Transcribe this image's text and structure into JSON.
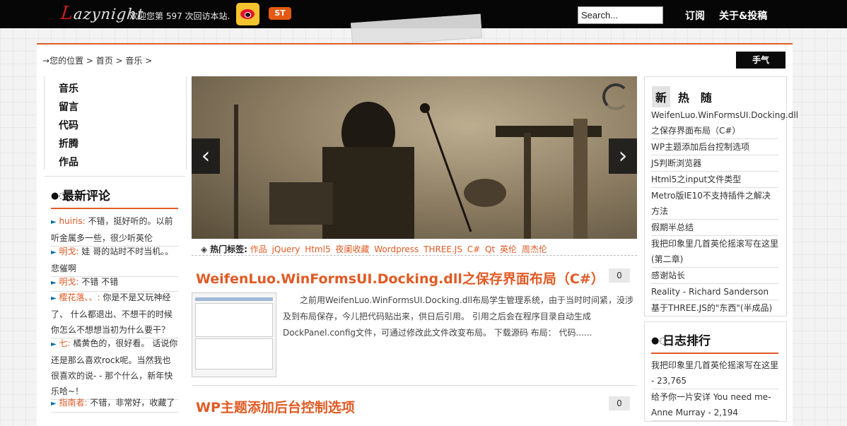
{
  "header": {
    "logo_text": "Lazynight",
    "logo_first": "L",
    "logo_rest": "azynight",
    "welcome": "欢迎您第 597 次回访本站.",
    "st_badge": "ST",
    "search_placeholder": "Search...",
    "nav": [
      "订阅",
      "关于&投稿"
    ]
  },
  "breadcrumb": {
    "arrow": "→",
    "text": "您的位置 > 首页 > 音乐 >"
  },
  "weather_button": "手气",
  "left_nav": [
    "音乐",
    "留言",
    "代码",
    "折腾",
    "作品"
  ],
  "recent_comments": {
    "title": "最新评论",
    "items": [
      {
        "name": "huiris:",
        "text": " 不错，挺好听的。以前听金属多一些，很少听英伦"
      },
      {
        "name": "明戈:",
        "text": " 娃 哥的站时不时当机。。悲催啊"
      },
      {
        "name": "明戈:",
        "text": " 不错 不错"
      },
      {
        "name": "樱花落、、:",
        "text": " 你是不是又玩神经了、 什么都退出、不想干的时候你怎么不想想当初为什么要干？"
      },
      {
        "name": "七:",
        "text": " 橘黄色的，很好看。 话说你还是那么喜欢rock呢。当然我也很喜欢的说- - 那个什么，新年快乐哈~！"
      },
      {
        "name": "指南者:",
        "text": " 不错，非常好，收藏了"
      }
    ]
  },
  "slider": {
    "prev_icon": "‹",
    "next_icon": "›"
  },
  "hot_tags": {
    "label": "热门标签:",
    "tags": [
      "作品",
      "jQuery",
      "Html5",
      "夜阑收藏",
      "Wordpress",
      "THREE.JS",
      "C#",
      "Qt",
      "英伦",
      "周杰伦"
    ]
  },
  "posts": [
    {
      "title": "WeifenLuo.WinFormsUI.Docking.dll之保存界面布局（C#）",
      "comments": "0",
      "excerpt": "之前用WeifenLuo.WinFormsUI.Docking.dll布局学生管理系统，由于当时时间紧，没涉及到布局保存，今儿把代码贴出来，供日后引用。 引用之后会在程序目录自动生成DockPanel.config文件，可通过修改此文件改变布局。 下载源码 布局： 代码......"
    },
    {
      "title": "WP主题添加后台控制选项",
      "comments": "0"
    }
  ],
  "sidebar": {
    "tabs": [
      "新",
      "热",
      "随"
    ],
    "new_posts": [
      "WeifenLuo.WinFormsUI.Docking.dll之保存界面布局（C#）",
      "WP主题添加后台控制选项",
      "JS判断浏览器",
      "Html5之input文件类型",
      "Metro版IE10不支持插件之解决方法",
      "假期半总结",
      "我把印象里几首英伦摇滚写在这里(第二章)",
      "感谢站长",
      "Reality - Richard Sanderson",
      "基于THREE.JS的\"东西\"(半成品)"
    ],
    "ranking_title": "日志排行",
    "ranking": [
      "我把印象里几首英伦摇滚写在这里 - 23,765",
      "给予你一片安详 You need me-Anne Murray - 2,194"
    ]
  },
  "colors": {
    "accent": "#e05a24",
    "topbar": "#060606",
    "link_blue": "#0b6aa8"
  }
}
